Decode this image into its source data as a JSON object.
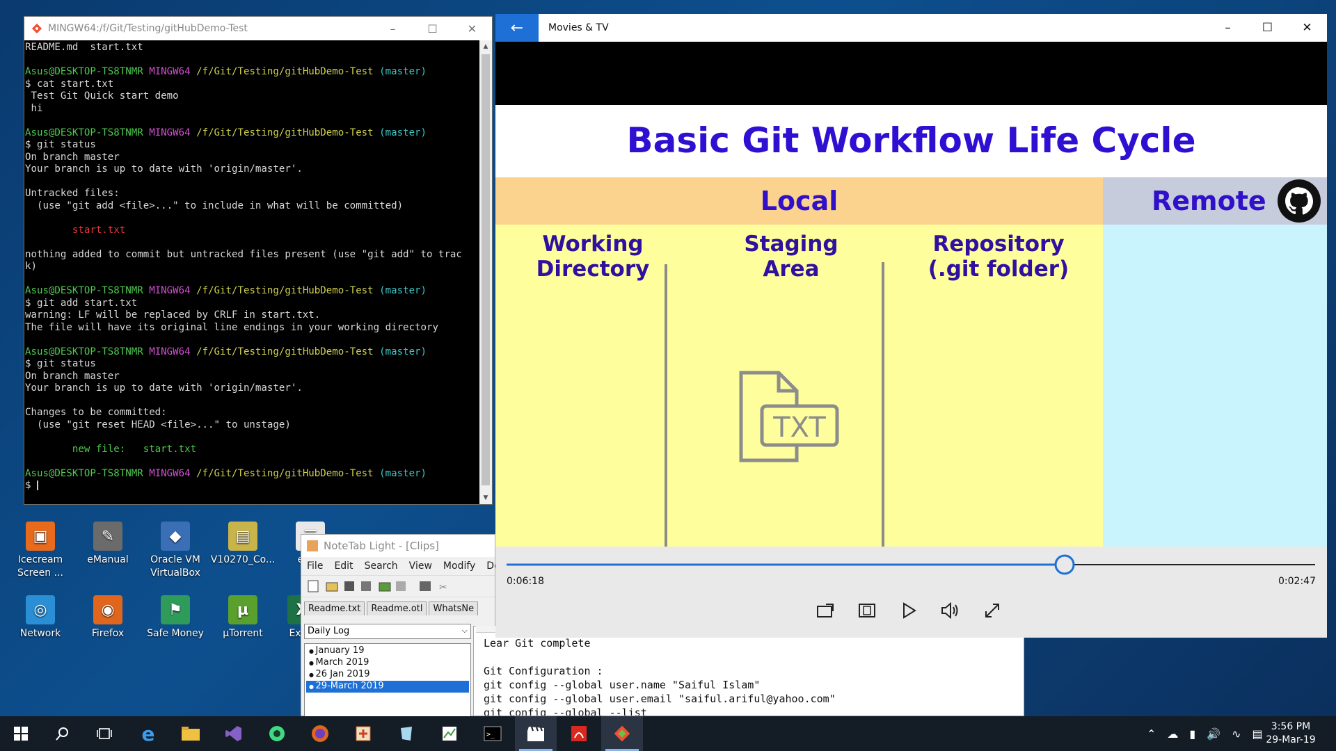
{
  "terminal": {
    "title": "MINGW64:/f/Git/Testing/gitHubDemo-Test",
    "lines": [
      [
        {
          "t": "README.md  start.txt",
          "c": ""
        }
      ],
      [
        {
          "t": "",
          "c": ""
        }
      ],
      [
        {
          "t": "Asus@DESKTOP-TS8TNMR ",
          "c": "c-g"
        },
        {
          "t": "MINGW64 ",
          "c": "c-m"
        },
        {
          "t": "/f/Git/Testing/gitHubDemo-Test ",
          "c": "c-y"
        },
        {
          "t": "(master)",
          "c": "c-c"
        }
      ],
      [
        {
          "t": "$ cat start.txt",
          "c": ""
        }
      ],
      [
        {
          "t": " Test Git Quick start demo",
          "c": ""
        }
      ],
      [
        {
          "t": " hi",
          "c": ""
        }
      ],
      [
        {
          "t": "",
          "c": ""
        }
      ],
      [
        {
          "t": "Asus@DESKTOP-TS8TNMR ",
          "c": "c-g"
        },
        {
          "t": "MINGW64 ",
          "c": "c-m"
        },
        {
          "t": "/f/Git/Testing/gitHubDemo-Test ",
          "c": "c-y"
        },
        {
          "t": "(master)",
          "c": "c-c"
        }
      ],
      [
        {
          "t": "$ git status",
          "c": ""
        }
      ],
      [
        {
          "t": "On branch master",
          "c": ""
        }
      ],
      [
        {
          "t": "Your branch is up to date with 'origin/master'.",
          "c": ""
        }
      ],
      [
        {
          "t": "",
          "c": ""
        }
      ],
      [
        {
          "t": "Untracked files:",
          "c": ""
        }
      ],
      [
        {
          "t": "  (use \"git add <file>...\" to include in what will be committed)",
          "c": ""
        }
      ],
      [
        {
          "t": "",
          "c": ""
        }
      ],
      [
        {
          "t": "        start.txt",
          "c": "c-r"
        }
      ],
      [
        {
          "t": "",
          "c": ""
        }
      ],
      [
        {
          "t": "nothing added to commit but untracked files present (use \"git add\" to trac",
          "c": ""
        }
      ],
      [
        {
          "t": "k)",
          "c": ""
        }
      ],
      [
        {
          "t": "",
          "c": ""
        }
      ],
      [
        {
          "t": "Asus@DESKTOP-TS8TNMR ",
          "c": "c-g"
        },
        {
          "t": "MINGW64 ",
          "c": "c-m"
        },
        {
          "t": "/f/Git/Testing/gitHubDemo-Test ",
          "c": "c-y"
        },
        {
          "t": "(master)",
          "c": "c-c"
        }
      ],
      [
        {
          "t": "$ git add start.txt",
          "c": ""
        }
      ],
      [
        {
          "t": "warning: LF will be replaced by CRLF in start.txt.",
          "c": ""
        }
      ],
      [
        {
          "t": "The file will have its original line endings in your working directory",
          "c": ""
        }
      ],
      [
        {
          "t": "",
          "c": ""
        }
      ],
      [
        {
          "t": "Asus@DESKTOP-TS8TNMR ",
          "c": "c-g"
        },
        {
          "t": "MINGW64 ",
          "c": "c-m"
        },
        {
          "t": "/f/Git/Testing/gitHubDemo-Test ",
          "c": "c-y"
        },
        {
          "t": "(master)",
          "c": "c-c"
        }
      ],
      [
        {
          "t": "$ git status",
          "c": ""
        }
      ],
      [
        {
          "t": "On branch master",
          "c": ""
        }
      ],
      [
        {
          "t": "Your branch is up to date with 'origin/master'.",
          "c": ""
        }
      ],
      [
        {
          "t": "",
          "c": ""
        }
      ],
      [
        {
          "t": "Changes to be committed:",
          "c": ""
        }
      ],
      [
        {
          "t": "  (use \"git reset HEAD <file>...\" to unstage)",
          "c": ""
        }
      ],
      [
        {
          "t": "",
          "c": ""
        }
      ],
      [
        {
          "t": "        new file:   start.txt",
          "c": "c-g"
        }
      ],
      [
        {
          "t": "",
          "c": ""
        }
      ],
      [
        {
          "t": "Asus@DESKTOP-TS8TNMR ",
          "c": "c-g"
        },
        {
          "t": "MINGW64 ",
          "c": "c-m"
        },
        {
          "t": "/f/Git/Testing/gitHubDemo-Test ",
          "c": "c-y"
        },
        {
          "t": "(master)",
          "c": "c-c"
        }
      ],
      [
        {
          "t": "$ ",
          "c": ""
        }
      ]
    ]
  },
  "movies": {
    "app_title": "Movies & TV",
    "slide": {
      "title": "Basic Git Workflow Life Cycle",
      "local": "Local",
      "remote": "Remote",
      "col1": "Working\nDirectory",
      "col2": "Staging\nArea",
      "col3": "Repository\n(.git folder)",
      "file_label": "TXT"
    },
    "elapsed": "0:06:18",
    "remaining": "0:02:47",
    "progress": 0.69
  },
  "notetab": {
    "title": "NoteTab Light  -  [Clips]",
    "menu": [
      "File",
      "Edit",
      "Search",
      "View",
      "Modify",
      "Do"
    ],
    "tabs": [
      "Readme.txt",
      "Readme.otl",
      "WhatsNe"
    ],
    "library": "Daily Log",
    "items": [
      "January 19",
      "March 2019",
      "26 Jan 2019",
      "29-March 2019"
    ],
    "selected_index": 3
  },
  "notepad_text": "Lear Git complete\n\nGit Configuration :\ngit config --global user.name \"Saiful Islam\"\ngit config --global user.email \"saiful.ariful@yahoo.com\"\ngit config --global --list",
  "desktop_icons": [
    {
      "label": "Icecream\nScreen ...",
      "color": "#e86a1c"
    },
    {
      "label": "eManual",
      "color": "#6b6b6b"
    },
    {
      "label": "Oracle VM\nVirtualBox",
      "color": "#3b6fb5"
    },
    {
      "label": "V10270_Co...",
      "color": "#c8b44a"
    },
    {
      "label": "essAl",
      "color": "#e8e8e8"
    },
    {
      "label": "Network",
      "color": "#2b8fd6"
    },
    {
      "label": "Firefox",
      "color": "#e0661d"
    },
    {
      "label": "Safe Money",
      "color": "#2e9b5a"
    },
    {
      "label": "µTorrent",
      "color": "#5aa02c"
    },
    {
      "label": "Excel",
      "color": "#1e7145"
    }
  ],
  "tray": {
    "time": "3:56 PM",
    "date": "29-Mar-19"
  }
}
